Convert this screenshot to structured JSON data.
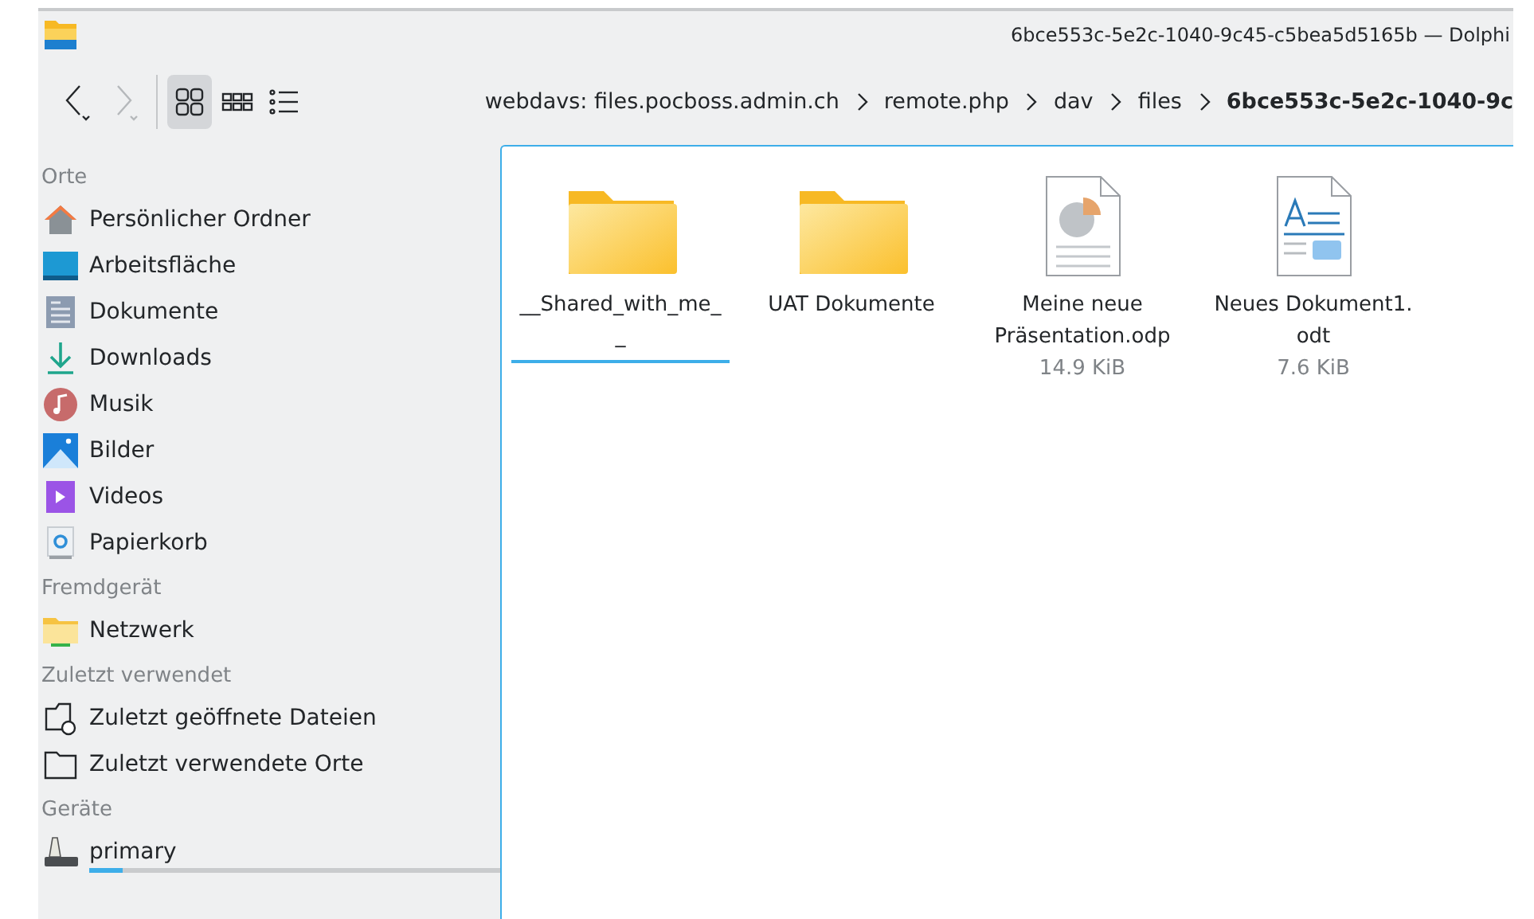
{
  "window": {
    "title": "6bce553c-5e2c-1040-9c45-c5bea5d5165b — Dolphi"
  },
  "toolbar": {
    "views": [
      {
        "kind": "icons",
        "selected": true
      },
      {
        "kind": "compact",
        "selected": false
      },
      {
        "kind": "details",
        "selected": false
      }
    ]
  },
  "breadcrumb": [
    {
      "label": "webdavs: files.pocboss.admin.ch",
      "current": false
    },
    {
      "label": "remote.php",
      "current": false
    },
    {
      "label": "dav",
      "current": false
    },
    {
      "label": "files",
      "current": false
    },
    {
      "label": "6bce553c-5e2c-1040-9c",
      "current": true
    }
  ],
  "sidebar": [
    {
      "heading": "Orte",
      "items": [
        {
          "label": "Persönlicher Ordner",
          "kind": "home"
        },
        {
          "label": "Arbeitsfläche",
          "kind": "desktop"
        },
        {
          "label": "Dokumente",
          "kind": "documents"
        },
        {
          "label": "Downloads",
          "kind": "downloads"
        },
        {
          "label": "Musik",
          "kind": "music"
        },
        {
          "label": "Bilder",
          "kind": "pictures"
        },
        {
          "label": "Videos",
          "kind": "videos"
        },
        {
          "label": "Papierkorb",
          "kind": "trash"
        }
      ]
    },
    {
      "heading": "Fremdgerät",
      "items": [
        {
          "label": "Netzwerk",
          "kind": "network"
        }
      ]
    },
    {
      "heading": "Zuletzt verwendet",
      "items": [
        {
          "label": "Zuletzt geöffnete Dateien",
          "kind": "recent"
        },
        {
          "label": "Zuletzt verwendete Orte",
          "kind": "places"
        }
      ]
    },
    {
      "heading": "Geräte",
      "items": [
        {
          "label": "primary",
          "kind": "drive",
          "level": 0.08
        }
      ]
    }
  ],
  "files": [
    {
      "name": "__Shared_with_me_\n_",
      "kind": "folder",
      "selected": true
    },
    {
      "name": "UAT Dokumente",
      "kind": "folder",
      "selected": false
    },
    {
      "name": "Meine neue Präsentation.odp",
      "size": "14.9 KiB",
      "kind": "presentation",
      "selected": false
    },
    {
      "name": "Neues Dokument1.\nodt",
      "size": "7.6 KiB",
      "kind": "document",
      "selected": false
    }
  ]
}
